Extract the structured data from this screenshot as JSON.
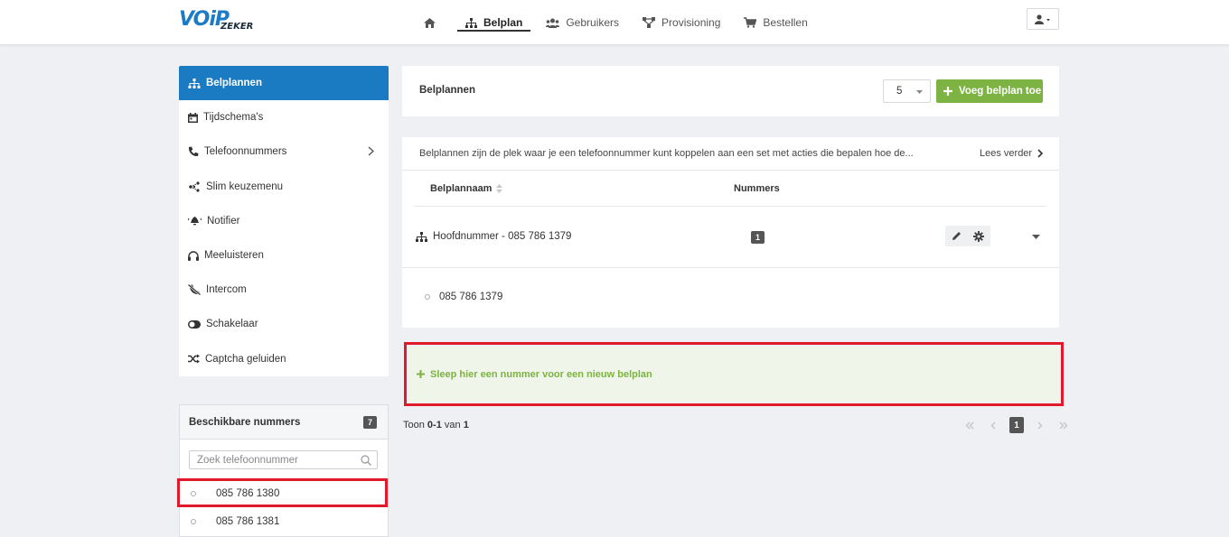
{
  "brand": {
    "logo_main": "VOiP",
    "logo_sub": "ZEKER"
  },
  "nav": {
    "items": [
      {
        "label": "",
        "icon": "home-icon"
      },
      {
        "label": "Belplan",
        "icon": "sitemap-icon",
        "active": true
      },
      {
        "label": "Gebruikers",
        "icon": "users-icon"
      },
      {
        "label": "Provisioning",
        "icon": "network-icon"
      },
      {
        "label": "Bestellen",
        "icon": "cart-icon"
      }
    ],
    "user_icon": "user-icon"
  },
  "sidebar": {
    "items": [
      {
        "label": "Belplannen",
        "icon": "sitemap-icon",
        "active": true
      },
      {
        "label": "Tijdschema's",
        "icon": "calendar-icon"
      },
      {
        "label": "Telefoonnummers",
        "icon": "phone-icon",
        "has_submenu": true
      },
      {
        "label": "Slim keuzemenu",
        "icon": "nodes-icon"
      },
      {
        "label": "Notifier",
        "icon": "bell-icon"
      },
      {
        "label": "Meeluisteren",
        "icon": "headphones-icon"
      },
      {
        "label": "Intercom",
        "icon": "phone-slash-icon"
      },
      {
        "label": "Schakelaar",
        "icon": "toggle-icon"
      },
      {
        "label": "Captcha geluiden",
        "icon": "shuffle-icon"
      }
    ]
  },
  "available": {
    "title": "Beschikbare nummers",
    "count": "7",
    "search_placeholder": "Zoek telefoonnummer",
    "numbers": [
      "085 786 1380",
      "085 786 1381"
    ]
  },
  "header": {
    "title": "Belplannen",
    "page_size": "5",
    "add_label": "Voeg belplan toe"
  },
  "info": {
    "text": "Belplannen zijn de plek waar je een telefoonnummer kunt koppelen aan een set met acties die bepalen hoe de...",
    "read_more": "Lees verder"
  },
  "table": {
    "col_name": "Belplannaam",
    "col_numbers": "Nummers",
    "rows": [
      {
        "name": "Hoofdnummer - 085 786 1379",
        "count": "1",
        "numbers": [
          "085 786 1379"
        ]
      }
    ]
  },
  "dropzone": {
    "label": "Sleep hier een nummer voor een nieuw belplan"
  },
  "pagination": {
    "prefix": "Toon",
    "range": "0-1",
    "mid": "van",
    "total": "1",
    "current_page": "1"
  },
  "colors": {
    "primary": "#1b7bc2",
    "success": "#7cb342",
    "highlight": "#e0192b",
    "dropzone_bg": "#f0f5e9"
  }
}
